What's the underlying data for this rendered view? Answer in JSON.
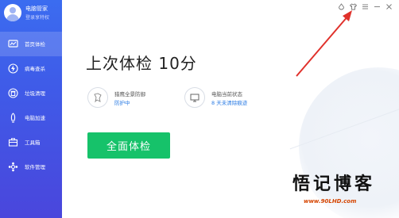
{
  "user": {
    "name": "电脑管家",
    "subtitle": "登录享特权"
  },
  "sidebar": {
    "items": [
      {
        "label": "首页体检",
        "icon": "dashboard-icon",
        "active": true
      },
      {
        "label": "病毒查杀",
        "icon": "lightning-icon",
        "active": false
      },
      {
        "label": "垃圾清理",
        "icon": "trash-icon",
        "active": false
      },
      {
        "label": "电脑加速",
        "icon": "rocket-icon",
        "active": false
      },
      {
        "label": "工具箱",
        "icon": "toolbox-icon",
        "active": false
      },
      {
        "label": "软件管理",
        "icon": "apps-icon",
        "active": false
      }
    ]
  },
  "topbar": {
    "icons": [
      "skin-icon",
      "shirt-icon",
      "menu-icon",
      "minimize-icon",
      "close-icon"
    ]
  },
  "main": {
    "title": "上次体检 10分",
    "status": [
      {
        "label": "猎鹰全景防御",
        "value": "防护中",
        "icon": "shield-bird-icon"
      },
      {
        "label": "电脑当前状态",
        "value": "8 天未清除痕迹",
        "icon": "monitor-icon"
      }
    ],
    "scan_button": "全面体检"
  },
  "watermark": {
    "text": "悟记博客",
    "url": "www.90LHD.com"
  },
  "colors": {
    "sidebar_top": "#3b6cf0",
    "sidebar_bottom": "#4a46dc",
    "accent_green": "#16c26a",
    "link_blue": "#2a7be4",
    "annotation_red": "#e0312b"
  }
}
